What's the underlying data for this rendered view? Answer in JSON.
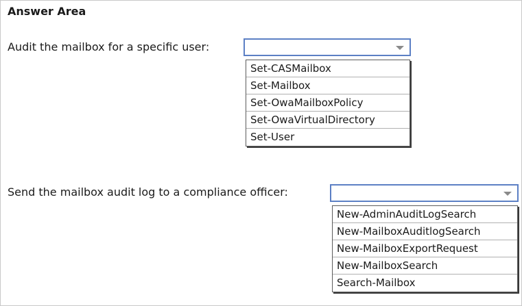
{
  "answer_area": {
    "title": "Answer Area"
  },
  "questions": [
    {
      "label": "Audit the mailbox for a specific user:",
      "selected": "",
      "options": [
        "Set-CASMailbox",
        "Set-Mailbox",
        "Set-OwaMailboxPolicy",
        "Set-OwaVirtualDirectory",
        "Set-User"
      ]
    },
    {
      "label": "Send the mailbox audit log to a compliance officer:",
      "selected": "",
      "options": [
        "New-AdminAuditLogSearch",
        "New-MailboxAuditlogSearch",
        "New-MailboxExportRequest",
        "New-MailboxSearch",
        "Search-Mailbox"
      ]
    }
  ],
  "colors": {
    "dropdown_border": "#5b7fc4",
    "frame_border": "#c8c8c8"
  },
  "icons": {
    "dropdown_arrow": "chevron-down-icon"
  }
}
